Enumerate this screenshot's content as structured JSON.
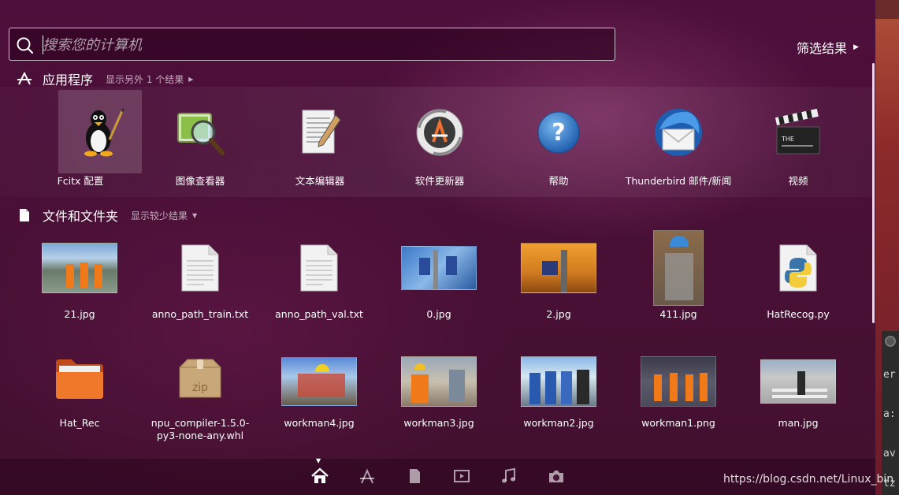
{
  "search": {
    "placeholder": "搜索您的计算机",
    "filter_label": "筛选结果"
  },
  "applications": {
    "title": "应用程序",
    "more": "显示另外 1 个结果",
    "items": [
      {
        "label": "Fcitx 配置",
        "icon": "penguin-icon"
      },
      {
        "label": "图像查看器",
        "icon": "image-viewer-icon"
      },
      {
        "label": "文本编辑器",
        "icon": "text-editor-icon"
      },
      {
        "label": "软件更新器",
        "icon": "software-updater-icon"
      },
      {
        "label": "帮助",
        "icon": "help-icon"
      },
      {
        "label": "Thunderbird 邮件/新闻",
        "icon": "thunderbird-icon"
      },
      {
        "label": "视频",
        "icon": "clapperboard-icon"
      }
    ]
  },
  "files": {
    "title": "文件和文件夹",
    "more": "显示较少结果",
    "row1": [
      {
        "label": "21.jpg",
        "icon": "image-thumbnail-icon"
      },
      {
        "label": "anno_path_train.txt",
        "icon": "text-file-icon"
      },
      {
        "label": "anno_path_val.txt",
        "icon": "text-file-icon"
      },
      {
        "label": "0.jpg",
        "icon": "image-thumbnail-icon"
      },
      {
        "label": "2.jpg",
        "icon": "image-thumbnail-icon"
      },
      {
        "label": "411.jpg",
        "icon": "image-thumbnail-icon"
      },
      {
        "label": "HatRecog.py",
        "icon": "python-file-icon"
      }
    ],
    "row2": [
      {
        "label": "Hat_Rec",
        "icon": "folder-icon"
      },
      {
        "label_line1": "npu_compiler-1.5.0-",
        "label_line2": "py3-none-any.whl",
        "icon": "zip-archive-icon"
      },
      {
        "label": "workman4.jpg",
        "icon": "image-thumbnail-icon"
      },
      {
        "label": "workman3.jpg",
        "icon": "image-thumbnail-icon"
      },
      {
        "label": "workman2.jpg",
        "icon": "image-thumbnail-icon"
      },
      {
        "label": "workman1.png",
        "icon": "image-thumbnail-icon"
      },
      {
        "label": "man.jpg",
        "icon": "image-thumbnail-icon"
      }
    ]
  },
  "lenses": [
    "home-icon",
    "applications-icon",
    "files-icon",
    "video-icon",
    "music-icon",
    "photo-icon"
  ],
  "terminal_fragments": [
    "er",
    "a:",
    "av",
    "tz"
  ],
  "watermark": "https://blog.csdn.net/Linux_bin"
}
